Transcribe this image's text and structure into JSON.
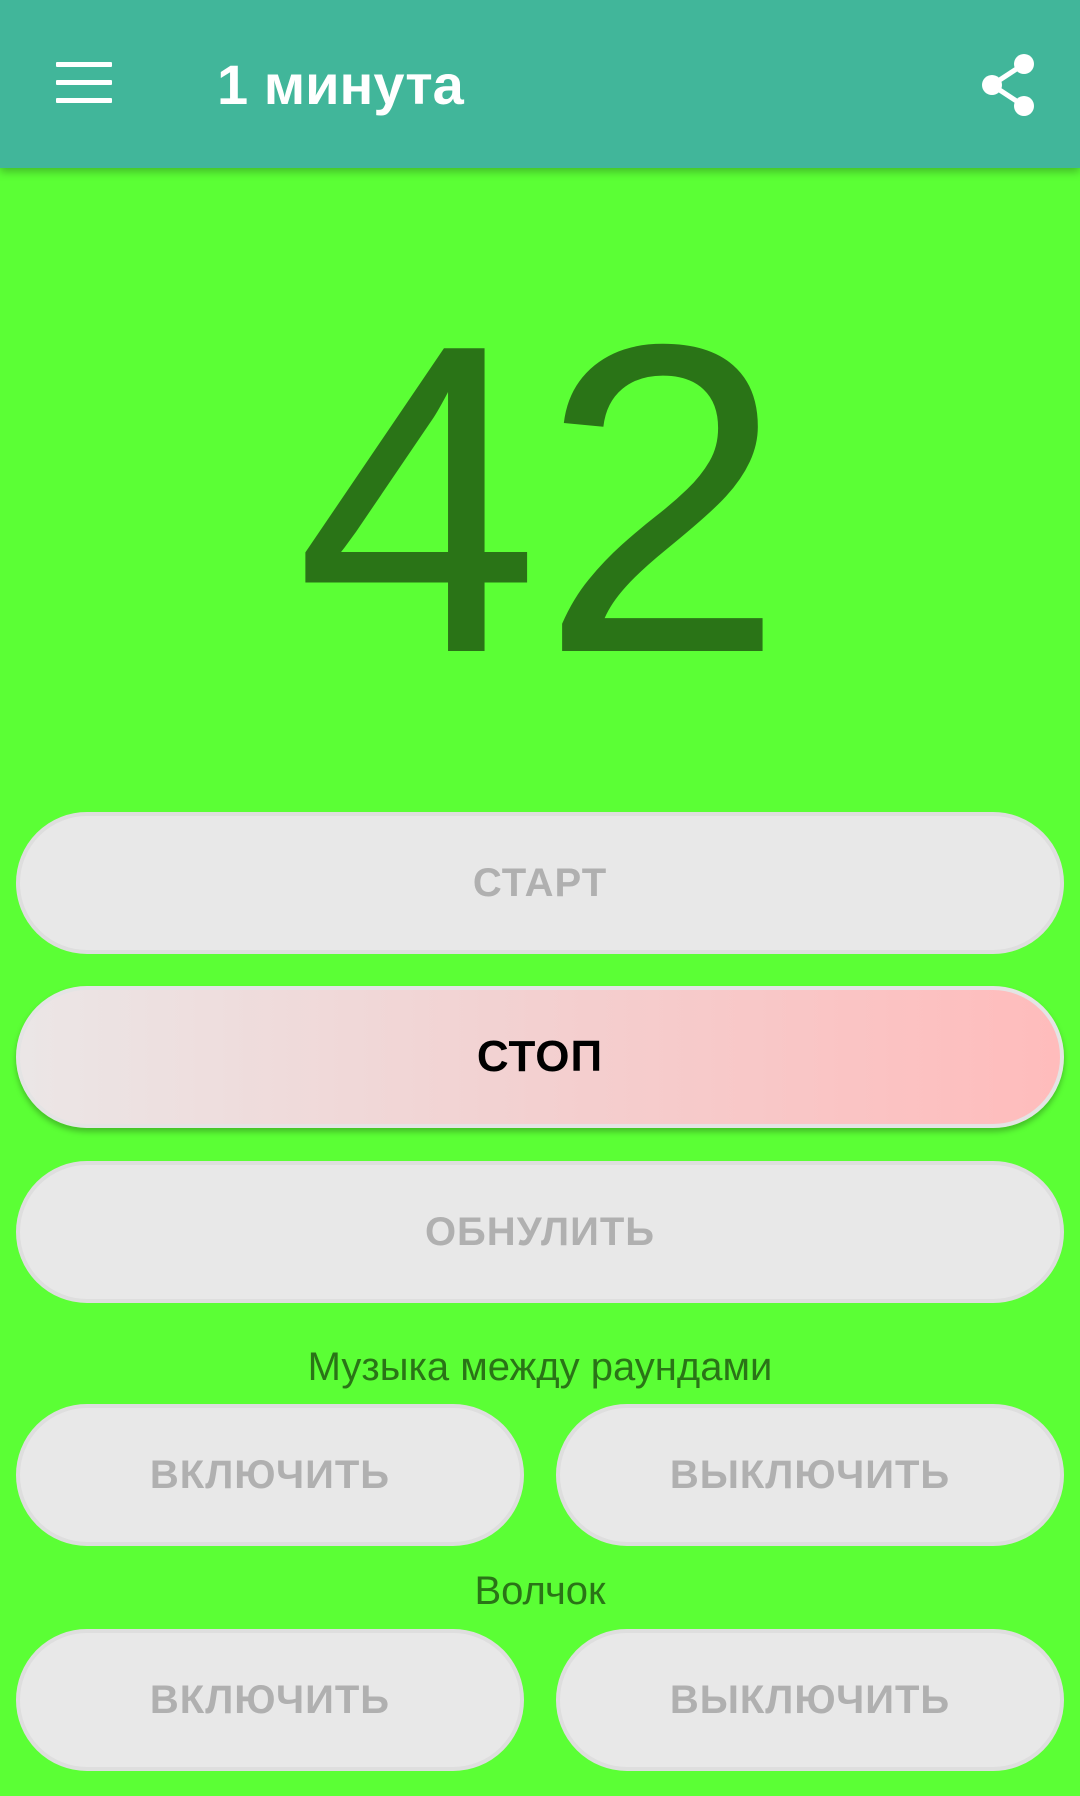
{
  "appbar": {
    "title": "1 минута",
    "menu_icon": "menu-icon",
    "share_icon": "share-icon"
  },
  "counter": {
    "value": "42"
  },
  "controls": {
    "start_label": "СТАРТ",
    "stop_label": "СТОП",
    "reset_label": "ОБНУЛИТЬ"
  },
  "music": {
    "heading": "Музыка между раундами",
    "on_label": "ВКЛЮЧИТЬ",
    "off_label": "ВЫКЛЮЧИТЬ"
  },
  "spinner": {
    "heading": "Волчок",
    "on_label": "ВКЛЮЧИТЬ",
    "off_label": "ВЫКЛЮЧИТЬ"
  },
  "colors": {
    "background": "#5bff35",
    "appbar": "#41b69a",
    "counter_text": "#2a7417",
    "stop_button_accent": "#ffbcbc"
  }
}
